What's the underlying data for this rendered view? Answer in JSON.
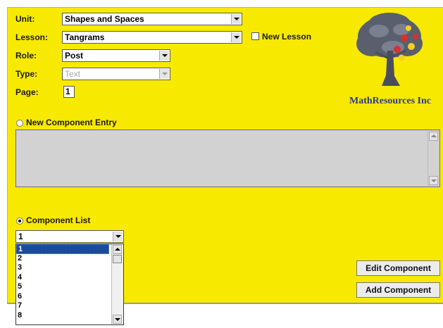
{
  "form": {
    "unit": {
      "label": "Unit:",
      "value": "Shapes and Spaces"
    },
    "lesson": {
      "label": "Lesson:",
      "value": "Tangrams"
    },
    "new_lesson_label": "New Lesson",
    "role": {
      "label": "Role:",
      "value": "Post"
    },
    "type": {
      "label": "Type:",
      "value": "Text"
    },
    "page": {
      "label": "Page:",
      "value": "1"
    }
  },
  "logo": {
    "text": "MathResources Inc",
    "icon": "tree-logo"
  },
  "new_component": {
    "label": "New Component Entry",
    "selected": false
  },
  "component_list": {
    "label": "Component List",
    "selected": true,
    "dropdown_value": "1",
    "options": [
      "1",
      "2",
      "3",
      "4",
      "5",
      "6",
      "7",
      "8"
    ],
    "selected_option": "1"
  },
  "buttons": {
    "edit": "Edit Component",
    "add": "Add Component"
  },
  "colors": {
    "background": "#f7e900",
    "selection": "#1a4a9e",
    "logo_text": "#2b3a8a"
  }
}
